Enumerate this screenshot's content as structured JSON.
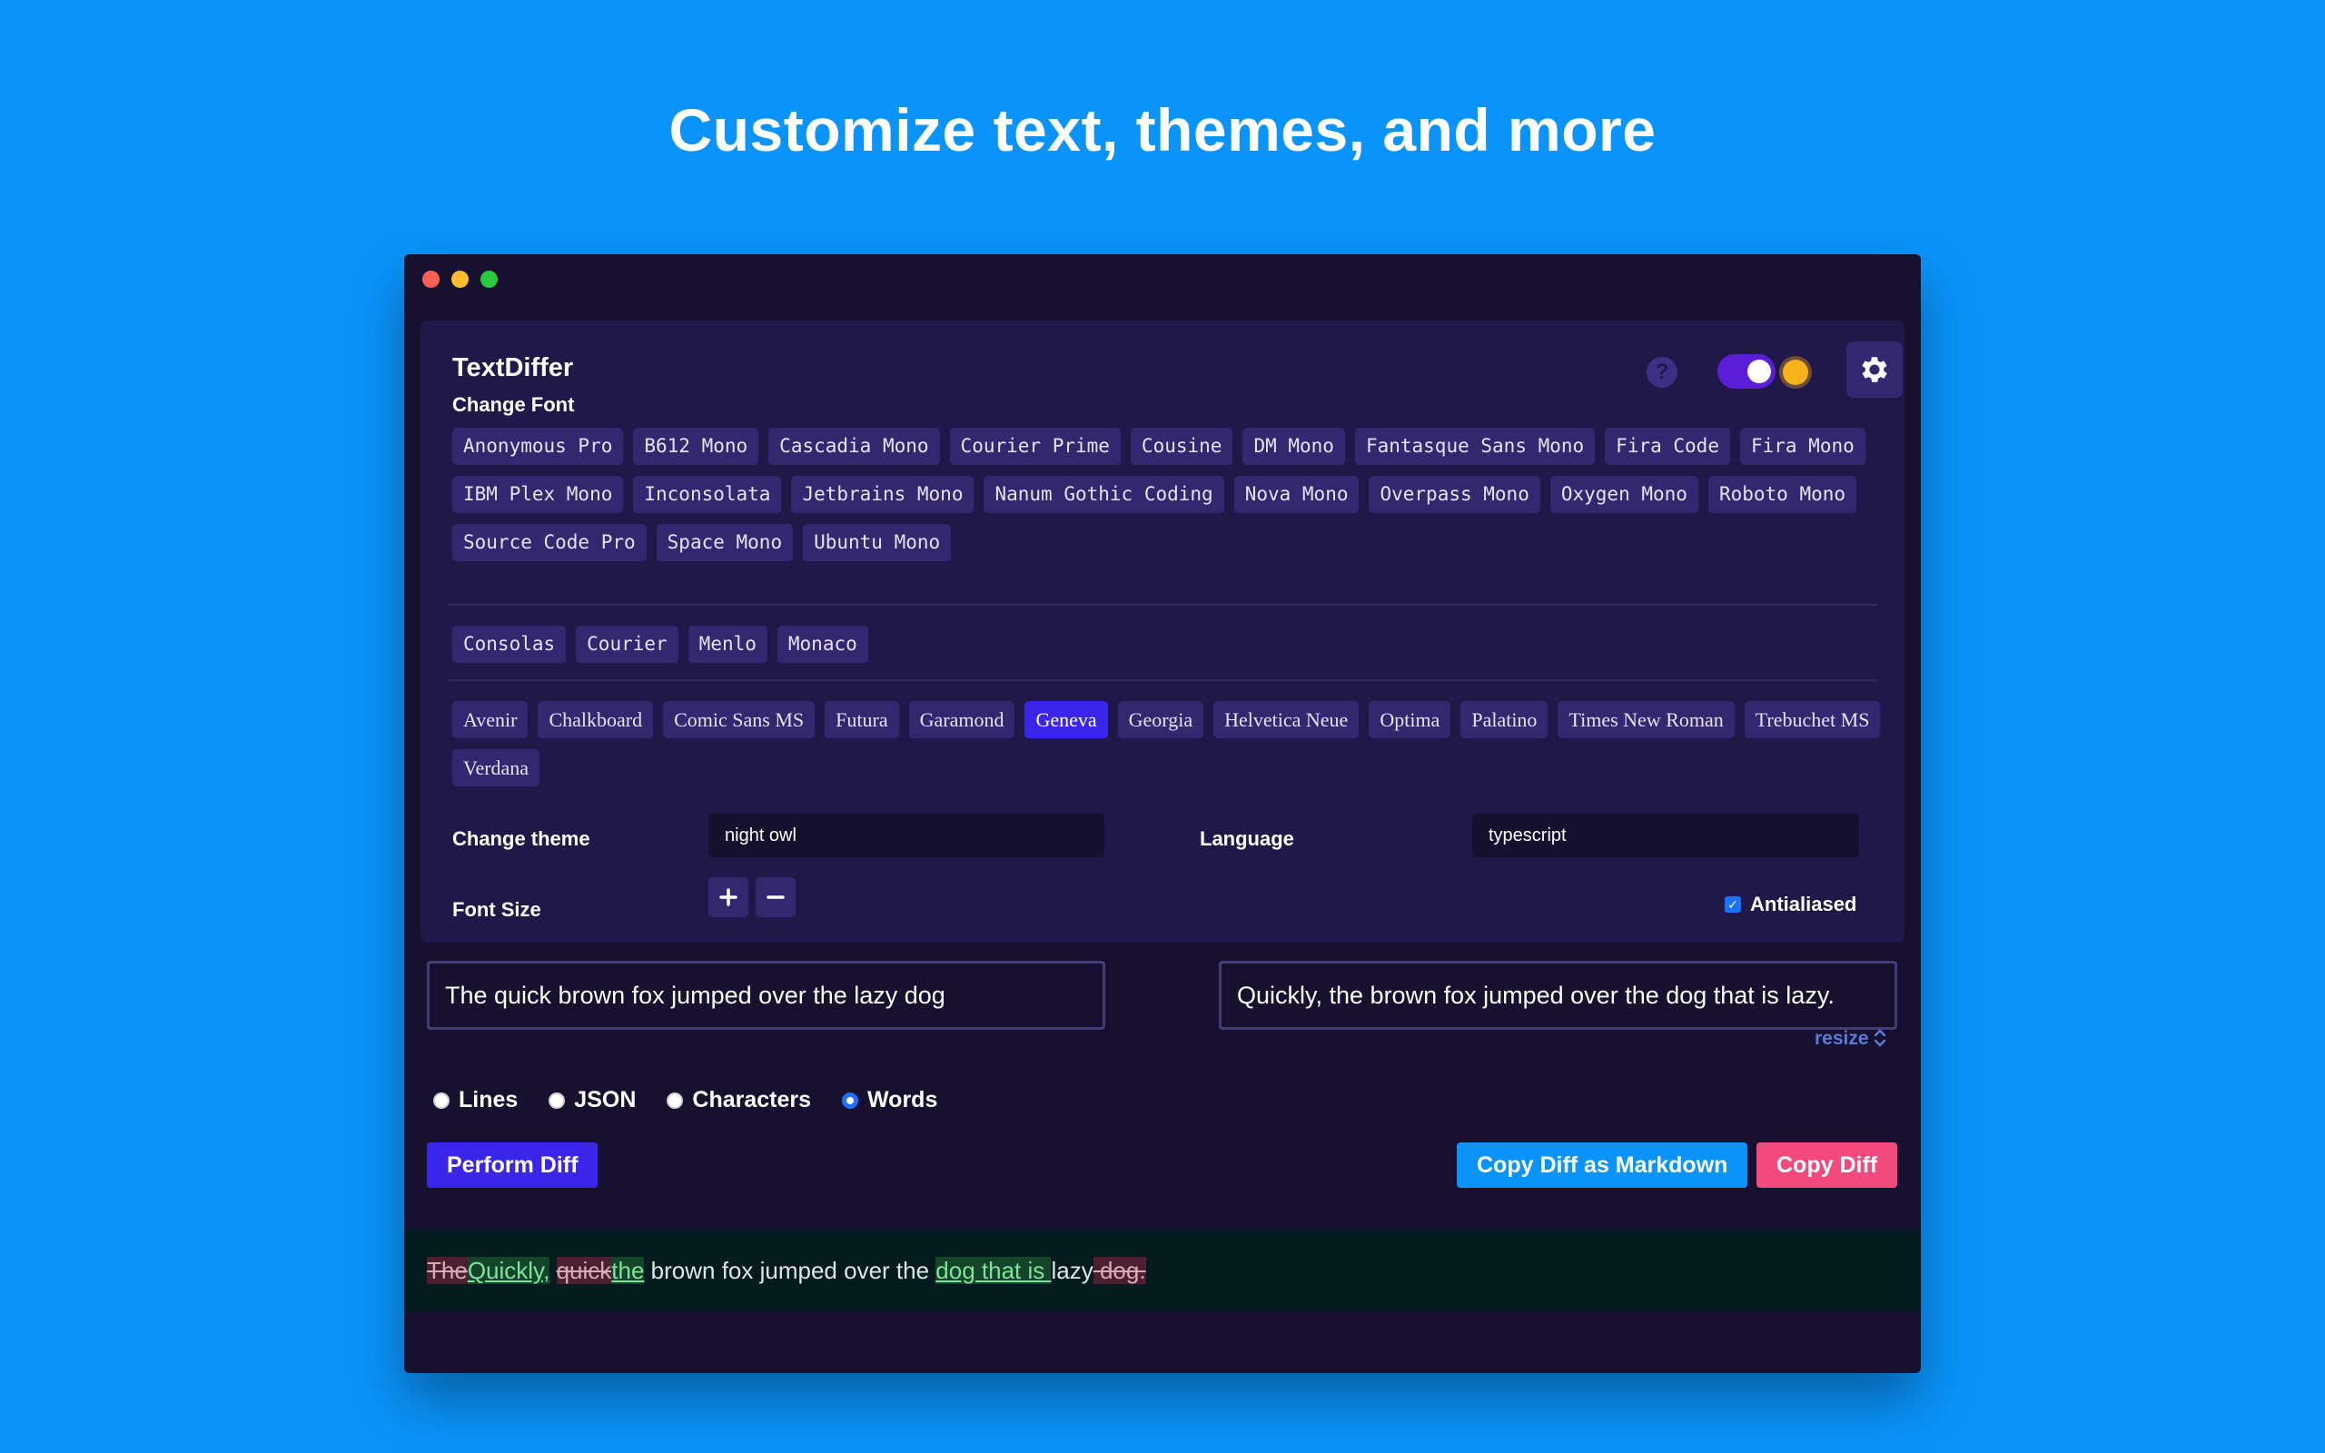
{
  "headline": "Customize text, themes, and more",
  "app": {
    "title": "TextDiffer",
    "help_label": "?"
  },
  "fonts": {
    "label": "Change Font",
    "group1": [
      "Anonymous Pro",
      "B612 Mono",
      "Cascadia Mono",
      "Courier Prime",
      "Cousine",
      "DM Mono",
      "Fantasque Sans Mono",
      "Fira Code",
      "Fira Mono",
      "IBM Plex Mono",
      "Inconsolata",
      "Jetbrains Mono",
      "Nanum Gothic Coding",
      "Nova Mono",
      "Overpass Mono",
      "Oxygen Mono",
      "Roboto Mono",
      "Source Code Pro",
      "Space Mono",
      "Ubuntu Mono"
    ],
    "group2": [
      "Consolas",
      "Courier",
      "Menlo",
      "Monaco"
    ],
    "group3": [
      "Avenir",
      "Chalkboard",
      "Comic Sans MS",
      "Futura",
      "Garamond",
      "Geneva",
      "Georgia",
      "Helvetica Neue",
      "Optima",
      "Palatino",
      "Times New Roman",
      "Trebuchet MS",
      "Verdana"
    ],
    "selected": "Geneva"
  },
  "theme": {
    "label": "Change theme",
    "value": "night owl"
  },
  "language": {
    "label": "Language",
    "value": "typescript"
  },
  "font_size": {
    "label": "Font Size",
    "plus": "+",
    "minus": "−"
  },
  "antialiased": {
    "label": "Antialiased",
    "checked": true
  },
  "inputs": {
    "left": "The quick brown fox jumped over the lazy dog",
    "right": "Quickly, the brown fox jumped over the dog that is lazy."
  },
  "resize_label": "resize",
  "modes": {
    "options": [
      "Lines",
      "JSON",
      "Characters",
      "Words"
    ],
    "selected": "Words"
  },
  "buttons": {
    "perform": "Perform Diff",
    "copy_markdown": "Copy Diff as Markdown",
    "copy": "Copy Diff"
  },
  "result": [
    {
      "t": "The",
      "k": "del"
    },
    {
      "t": "Quickly,",
      "k": "add"
    },
    {
      "t": " ",
      "k": "eq"
    },
    {
      "t": "quick",
      "k": "del"
    },
    {
      "t": "the",
      "k": "add"
    },
    {
      "t": " brown fox jumped over the ",
      "k": "eq"
    },
    {
      "t": "dog that is ",
      "k": "add"
    },
    {
      "t": "lazy",
      "k": "eq"
    },
    {
      "t": " dog.",
      "k": "del"
    }
  ],
  "colors": {
    "background": "#0a94fb",
    "window": "#17112f",
    "panel": "#21184a",
    "chip": "#332870",
    "accent": "#3a26e8",
    "copy": "#f24a7d"
  }
}
